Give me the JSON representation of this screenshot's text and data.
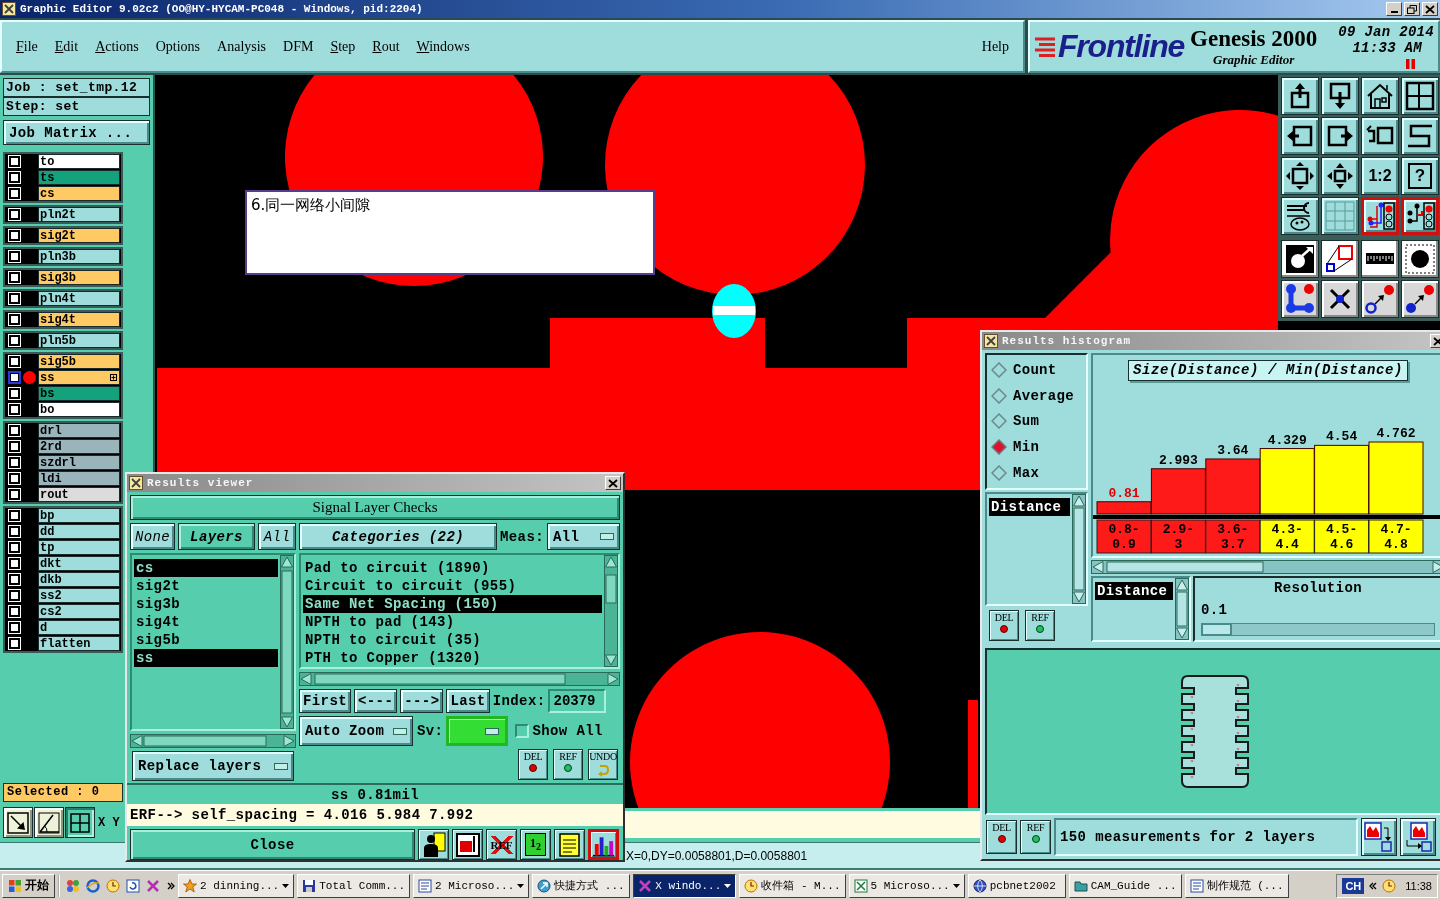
{
  "window": {
    "title": "Graphic Editor 9.02c2 (OO@HY-HYCAM-PC048 - Windows, pid:2204)"
  },
  "menu": {
    "items": [
      {
        "label": "File",
        "mnemonic": true
      },
      {
        "label": "Edit",
        "mnemonic": true
      },
      {
        "label": "Actions",
        "mnemonic": true
      },
      {
        "label": "Options",
        "mnemonic": false
      },
      {
        "label": "Analysis",
        "mnemonic": false
      },
      {
        "label": "DFM",
        "mnemonic": false
      },
      {
        "label": "Step",
        "mnemonic": true
      },
      {
        "label": "Rout",
        "mnemonic": true
      },
      {
        "label": "Windows",
        "mnemonic": true
      }
    ],
    "help": {
      "label": "Help",
      "mnemonic": false
    }
  },
  "brand": {
    "logo": "Frontline",
    "product": "Genesis 2000",
    "subtitle": "Graphic Editor",
    "date": "09 Jan 2014",
    "time": "11:33 AM"
  },
  "job_panel": {
    "job": "Job : set_tmp.12",
    "step": "Step: set",
    "matrix_button": "Job Matrix ...",
    "layer_groups": [
      {
        "layers": [
          {
            "name": "to",
            "color": "#ffffff",
            "checked": false,
            "active": false
          },
          {
            "name": "ts",
            "color": "#14a27c",
            "checked": false,
            "active": false
          },
          {
            "name": "cs",
            "color": "#ffc964",
            "checked": false,
            "active": false
          }
        ]
      },
      {
        "layers": [
          {
            "name": "pln2t",
            "color": "#9fdcdc",
            "checked": false,
            "active": false
          }
        ]
      },
      {
        "layers": [
          {
            "name": "sig2t",
            "color": "#ffc964",
            "checked": false,
            "active": false
          }
        ]
      },
      {
        "layers": [
          {
            "name": "pln3b",
            "color": "#9fdcdc",
            "checked": false,
            "active": false
          }
        ]
      },
      {
        "layers": [
          {
            "name": "sig3b",
            "color": "#ffc964",
            "checked": false,
            "active": false
          }
        ]
      },
      {
        "layers": [
          {
            "name": "pln4t",
            "color": "#9fdcdc",
            "checked": false,
            "active": false
          }
        ]
      },
      {
        "layers": [
          {
            "name": "sig4t",
            "color": "#ffc964",
            "checked": false,
            "active": false
          }
        ]
      },
      {
        "layers": [
          {
            "name": "pln5b",
            "color": "#9fdcdc",
            "checked": false,
            "active": false
          }
        ]
      },
      {
        "layers": [
          {
            "name": "sig5b",
            "color": "#ffc964",
            "checked": false,
            "active": false
          },
          {
            "name": "ss",
            "color": "#ffc964",
            "checked": false,
            "active": true
          },
          {
            "name": "bs",
            "color": "#14a27c",
            "checked": false,
            "active": false
          },
          {
            "name": "bo",
            "color": "#ffffff",
            "checked": false,
            "active": false
          }
        ]
      },
      {
        "layers": [
          {
            "name": "drl",
            "color": "#9ab4bc",
            "checked": false,
            "active": false
          },
          {
            "name": "2rd",
            "color": "#9ab4bc",
            "checked": false,
            "active": false
          },
          {
            "name": "szdrl",
            "color": "#9ab4bc",
            "checked": false,
            "active": false
          },
          {
            "name": "ldi",
            "color": "#9ab4bc",
            "checked": false,
            "active": false
          },
          {
            "name": "rout",
            "color": "#dcdcdc",
            "checked": false,
            "active": false
          }
        ]
      },
      {
        "layers": [
          {
            "name": "bp",
            "color": "#9fdcdc",
            "checked": false,
            "active": false
          },
          {
            "name": "dd",
            "color": "#9fdcdc",
            "checked": false,
            "active": false
          },
          {
            "name": "tp",
            "color": "#9fdcdc",
            "checked": false,
            "active": false
          },
          {
            "name": "dkt",
            "color": "#9fdcdc",
            "checked": false,
            "active": false
          },
          {
            "name": "dkb",
            "color": "#9fdcdc",
            "checked": false,
            "active": false
          },
          {
            "name": "ss2",
            "color": "#9fdcdc",
            "checked": false,
            "active": false
          },
          {
            "name": "cs2",
            "color": "#9fdcdc",
            "checked": false,
            "active": false
          },
          {
            "name": "d",
            "color": "#9fdcdc",
            "checked": false,
            "active": false
          },
          {
            "name": "flatten",
            "color": "#9fdcdc",
            "checked": false,
            "active": false
          }
        ]
      }
    ],
    "selected_count": "Selected : 0",
    "view_buttons": [
      {
        "on": false
      },
      {
        "on": false
      },
      {
        "on": true
      }
    ],
    "coordinates_label": "X Y"
  },
  "canvas": {
    "note": "6.同一网络小间隙"
  },
  "toolbar": {
    "buttons": [
      {
        "on": false
      },
      {
        "on": false
      },
      {
        "on": false
      },
      {
        "on": false
      },
      {
        "on": false
      },
      {
        "on": false
      },
      {
        "on": false
      },
      {
        "on": false
      },
      {
        "on": false
      },
      {
        "on": false
      },
      {
        "on": false,
        "label": "1:2"
      },
      {
        "on": false,
        "label": "?"
      },
      {
        "on": false
      },
      {
        "on": false
      },
      {
        "on": true
      },
      {
        "on": true
      },
      {
        "on": false
      },
      {
        "on": false
      },
      {
        "on": false
      },
      {
        "on": false
      },
      {
        "on": false
      },
      {
        "on": false
      },
      {
        "on": false
      },
      {
        "on": false
      }
    ]
  },
  "results_viewer": {
    "title": "Results viewer",
    "heading": "Signal Layer Checks",
    "layer_buttons": [
      {
        "label": "None",
        "kind": "action"
      },
      {
        "label": "Layers",
        "kind": "header"
      },
      {
        "label": "All",
        "kind": "action"
      }
    ],
    "layers": [
      {
        "name": "cs",
        "selected": true
      },
      {
        "name": "sig2t",
        "selected": false
      },
      {
        "name": "sig3b",
        "selected": false
      },
      {
        "name": "sig4t",
        "selected": false
      },
      {
        "name": "sig5b",
        "selected": false
      },
      {
        "name": "ss",
        "selected": true
      }
    ],
    "layer_mode": "Replace layers",
    "categories_button": "Categories (22)",
    "meas_label": "Meas:",
    "meas_value": "All",
    "categories": [
      {
        "label": "Pad to circuit (1890)",
        "selected": false
      },
      {
        "label": "Circuit to circuit (955)",
        "selected": false
      },
      {
        "label": "Same Net Spacing (150)",
        "selected": true
      },
      {
        "label": "NPTH to pad (143)",
        "selected": false
      },
      {
        "label": "NPTH to circuit (35)",
        "selected": false
      },
      {
        "label": "PTH to Copper (1320)",
        "selected": false
      }
    ],
    "nav_buttons": [
      "First",
      "<---",
      "--->",
      "Last"
    ],
    "index_label": "Index:",
    "index_value": "20379",
    "zoom_mode": "Auto Zoom",
    "severity": {
      "label": "Sv:",
      "color": "#33dd33"
    },
    "show_all": {
      "label": "Show All",
      "checked": false
    },
    "edit_buttons": [
      "DEL",
      "REF",
      "UNDO"
    ],
    "measurement": "ss 0.81mil",
    "erf_line": "ERF--> self_spacing = 4.016 5.984 7.992",
    "close_button": "Close",
    "tool_buttons": [
      {
        "on": false
      },
      {
        "on": false
      },
      {
        "on": false,
        "label": "REF"
      },
      {
        "on": false,
        "label": "1$_{2}$"
      },
      {
        "on": false
      },
      {
        "on": true
      }
    ]
  },
  "results_histogram": {
    "title": "Results histogram",
    "functions": [
      {
        "label": "Count",
        "selected": false
      },
      {
        "label": "Average",
        "selected": false
      },
      {
        "label": "Sum",
        "selected": false
      },
      {
        "label": "Min",
        "selected": true
      },
      {
        "label": "Max",
        "selected": false
      }
    ],
    "fields": [
      {
        "label": "Distance",
        "selected": true
      }
    ],
    "field_buttons": [
      "DEL",
      "REF"
    ],
    "chart_data": {
      "type": "bar",
      "title": "Size(Distance) / Min(Distance)",
      "categories": [
        "0.8-0.9",
        "2.9-3",
        "3.6-3.7",
        "4.3-4.4",
        "4.5-4.6",
        "4.7-4.8"
      ],
      "series": [
        {
          "color": "#ff1a1a",
          "values": [
            0.81,
            2.993,
            3.64,
            null,
            null,
            null
          ]
        },
        {
          "color": "#ffff00",
          "values": [
            null,
            null,
            null,
            4.329,
            4.54,
            4.762
          ]
        }
      ],
      "stacked": true,
      "data_labels": true
    },
    "group_fields": [
      {
        "label": "Distance",
        "selected": true
      }
    ],
    "resolution": {
      "label": "Resolution",
      "value": "0.1",
      "level": 0
    },
    "summary_buttons": [
      "DEL",
      "REF"
    ],
    "summary": "150 measurements for 2 layers"
  },
  "status_bar": {
    "text": "X=0,DY=0.0058801,D=0.0058801"
  },
  "taskbar": {
    "start": "开始",
    "tasks": [
      {
        "label": "2 dinning...",
        "grouped": true,
        "selected": false
      },
      {
        "label": "Total Comm...",
        "grouped": false,
        "selected": false
      },
      {
        "label": "2 Microso...",
        "grouped": true,
        "selected": false
      },
      {
        "label": "快捷方式 ...",
        "grouped": false,
        "selected": false
      },
      {
        "label": "X windo...",
        "grouped": true,
        "selected": true
      },
      {
        "label": "收件箱 - M...",
        "grouped": false,
        "selected": false
      },
      {
        "label": "5 Microso...",
        "grouped": true,
        "selected": false
      },
      {
        "label": "pcbnet2002",
        "grouped": false,
        "selected": false
      },
      {
        "label": "CAM_Guide ...",
        "grouped": false,
        "selected": false
      },
      {
        "label": "制作规范 (...",
        "grouped": false,
        "selected": false
      }
    ],
    "language": "CH",
    "clock": "11:38"
  }
}
